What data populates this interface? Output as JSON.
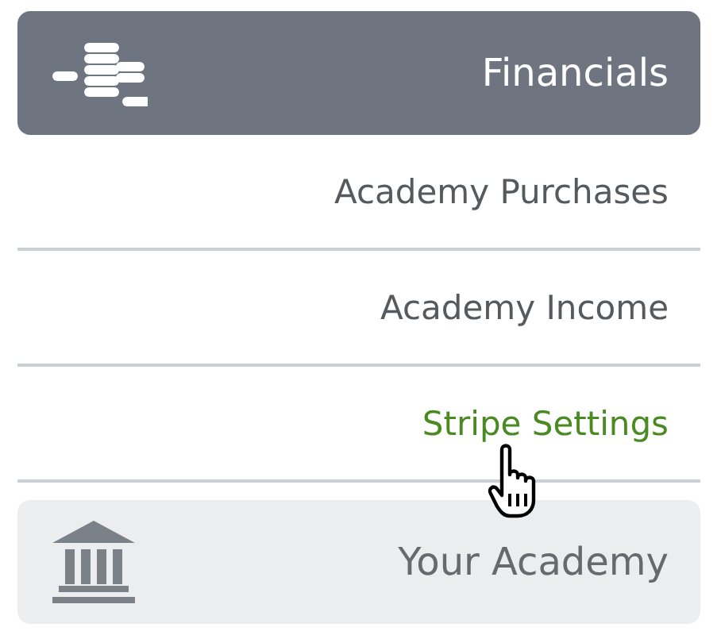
{
  "sections": [
    {
      "title": "Financials",
      "kind": "coins",
      "expanded": true,
      "items": [
        {
          "label": "Academy Purchases",
          "selected": false
        },
        {
          "label": "Academy Income",
          "selected": false
        },
        {
          "label": "Stripe Settings",
          "selected": true
        }
      ]
    },
    {
      "title": "Your Academy",
      "kind": "bank",
      "expanded": false
    }
  ]
}
